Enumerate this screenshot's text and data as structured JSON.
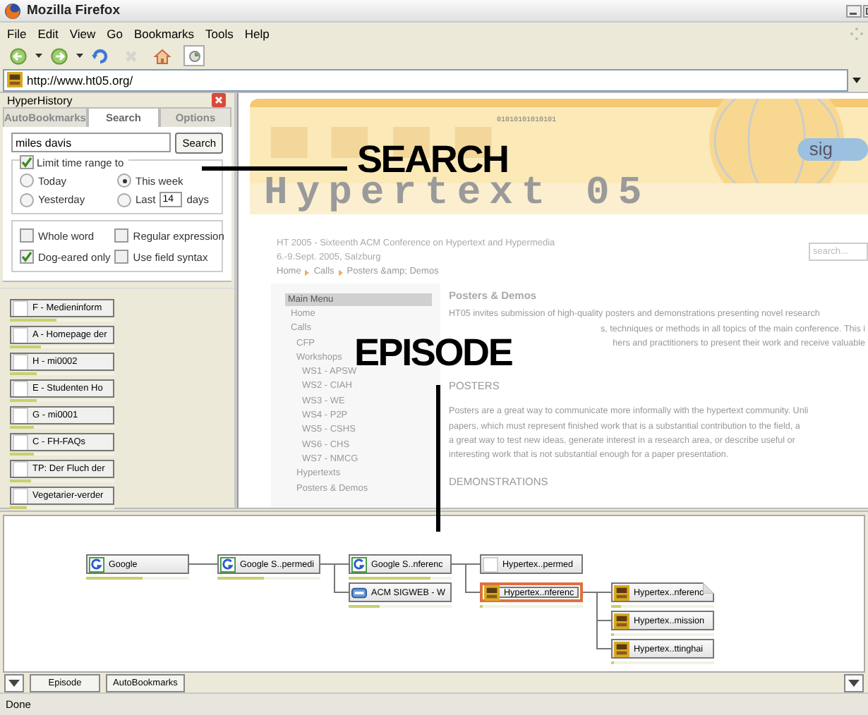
{
  "window": {
    "title": "Mozilla Firefox"
  },
  "menu": [
    "File",
    "Edit",
    "View",
    "Go",
    "Bookmarks",
    "Tools",
    "Help"
  ],
  "toolbar": [
    {
      "kind": "back",
      "disabled": false
    },
    {
      "kind": "forward",
      "disabled": false
    },
    {
      "kind": "reload",
      "disabled": false
    },
    {
      "kind": "stop",
      "disabled": true
    },
    {
      "kind": "home",
      "disabled": false
    },
    {
      "kind": "tab",
      "disabled": false
    }
  ],
  "url": "http://www.ht05.org/",
  "sidebar": {
    "title": "HyperHistory",
    "tabs": [
      {
        "label": "AutoBookmarks",
        "selected": false
      },
      {
        "label": "Search",
        "selected": true
      },
      {
        "label": "Options",
        "selected": false
      }
    ],
    "query": "miles davis",
    "search_button": "Search",
    "limit": {
      "label": "Limit time range to",
      "checked": true
    },
    "time_options": [
      {
        "kind": "plain",
        "label": "Today",
        "selected": false
      },
      {
        "kind": "plain",
        "label": "This week",
        "selected": true
      },
      {
        "kind": "plain",
        "label": "Yesterday",
        "selected": false
      },
      {
        "kind": "last",
        "label": "Last",
        "value": "14",
        "unit": "days",
        "selected": false
      }
    ],
    "search_options": [
      {
        "label": "Whole word",
        "checked": false
      },
      {
        "label": "Regular expression",
        "checked": false
      },
      {
        "label": "Dog-eared only",
        "checked": true
      },
      {
        "label": "Use field syntax",
        "checked": false
      }
    ],
    "results": [
      {
        "label": "F - Medieninform",
        "level": 0.45
      },
      {
        "label": "A - Homepage der",
        "level": 0.3
      },
      {
        "label": "H - mi0002",
        "level": 0.26
      },
      {
        "label": "E - Studenten Ho",
        "level": 0.26
      },
      {
        "label": "G - mi0001",
        "level": 0.23
      },
      {
        "label": "C - FH-FAQs",
        "level": 0.23
      },
      {
        "label": "TP: Der Fluch der",
        "level": 0.2
      },
      {
        "label": "Vegetarier-verder",
        "level": 0.16
      }
    ]
  },
  "page": {
    "banner": {
      "binary": "01010101010101",
      "title": "Hypertext 05",
      "logo": "sig"
    },
    "heading": "HT 2005 - Sixteenth ACM Conference on Hypertext and Hypermedia",
    "date": "6.-9.Sept. 2005, Salzburg",
    "breadcrumb": [
      "Home",
      "Calls",
      "Posters &amp; Demos"
    ],
    "search": {
      "placeholder": "search..."
    },
    "menu": {
      "title": "Main Menu",
      "items": [
        {
          "label": "Home"
        },
        {
          "label": "Calls",
          "children": [
            {
              "label": "CFP"
            },
            {
              "label": "Workshops",
              "children": [
                {
                  "label": "WS1 - APSW"
                },
                {
                  "label": "WS2 - CIAH"
                },
                {
                  "label": "WS3 - WE"
                },
                {
                  "label": "WS4 - P2P"
                },
                {
                  "label": "WS5 - CSHS"
                },
                {
                  "label": "WS6 - CHS"
                },
                {
                  "label": "WS7 - NMCG"
                }
              ]
            },
            {
              "label": "Hypertexts"
            },
            {
              "label": "Posters & Demos"
            }
          ]
        }
      ]
    },
    "content": [
      {
        "kind": "title",
        "text": "Posters & Demos"
      },
      {
        "kind": "line",
        "text": "HT05 invites submission of high-quality posters and demonstrations presenting novel research"
      },
      {
        "kind": "partial",
        "text": "s, techniques or methods in all topics of the main conference. This i"
      },
      {
        "kind": "partial",
        "text": "hers and practitioners to present their work and receive valuable"
      },
      {
        "kind": "heading",
        "text": "POSTERS"
      },
      {
        "kind": "line",
        "text": "Posters are a great way to communicate more informally with the hypertext community. Unli"
      },
      {
        "kind": "line",
        "text": "papers, which must represent finished work that is a substantial contribution to the field, a"
      },
      {
        "kind": "line",
        "text": "a great way to test new ideas, generate interest in a research area, or describe useful or"
      },
      {
        "kind": "line",
        "text": "interesting work that is not substantial enough for a paper presentation."
      },
      {
        "kind": "heading",
        "text": "DEMONSTRATIONS"
      }
    ]
  },
  "episode": {
    "nodes": [
      {
        "label": "Google",
        "kind": "google",
        "level": 0.55,
        "selected": false,
        "dog_eared": false,
        "children": [
          {
            "label": "Google S..permedi",
            "kind": "google",
            "level": 0.45,
            "selected": false,
            "dog_eared": false,
            "children": [
              {
                "label": "Google S..nferenc",
                "kind": "google",
                "level": 0.8,
                "selected": false,
                "dog_eared": false,
                "children": [
                  {
                    "label": "Hypertex..permed",
                    "kind": "blank",
                    "selected": false,
                    "dog_eared": false
                  },
                  {
                    "label": "Hypertex..nferenc",
                    "kind": "ht",
                    "level": 0.03,
                    "selected": true,
                    "dog_eared": false,
                    "children": [
                      {
                        "label": "Hypertex..nferenc",
                        "kind": "ht",
                        "level": 0.1,
                        "selected": false,
                        "dog_eared": true
                      },
                      {
                        "label": "Hypertex..mission",
                        "kind": "ht",
                        "level": 0.03,
                        "selected": false,
                        "dog_eared": false
                      },
                      {
                        "label": "Hypertex..ttinghai",
                        "kind": "ht",
                        "level": 0.03,
                        "selected": false,
                        "dog_eared": false
                      }
                    ]
                  }
                ]
              },
              {
                "label": "ACM SIGWEB - W",
                "kind": "acm",
                "level": 0.3,
                "selected": false,
                "dog_eared": false
              }
            ]
          }
        ]
      }
    ]
  },
  "bottom_buttons": [
    "Episode",
    "AutoBookmarks"
  ],
  "status": "Done",
  "annotations": [
    {
      "text": "SEARCH"
    },
    {
      "text": "EPISODE"
    }
  ]
}
